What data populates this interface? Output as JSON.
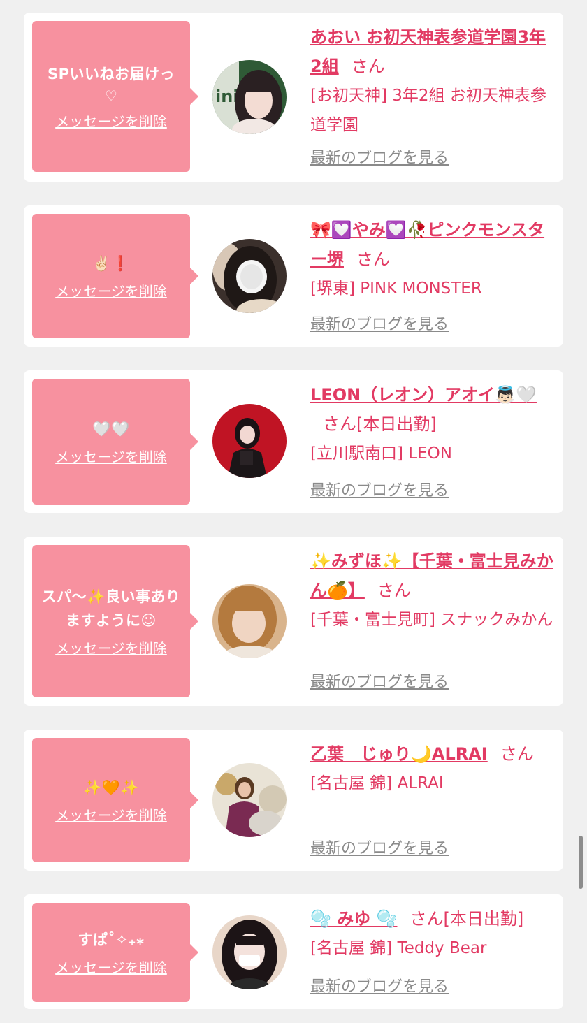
{
  "colors": {
    "accent": "#e23a63",
    "message_bg": "#f7919f",
    "page_bg": "#f0f0f0",
    "link_gray": "#8a8a8a"
  },
  "entries": [
    {
      "message": "SPいいねお届けっ",
      "message_sub": "♡",
      "delete_label": "メッセージを削除",
      "name": "あおい お初天神表参道学園3年2組",
      "honorific": "さん",
      "extra": "",
      "shop": "[お初天神] 3年2組 お初天神表参道学園",
      "blog_label": "最新のブログを見る"
    },
    {
      "message": "✌🏻❗️",
      "message_sub": "",
      "delete_label": "メッセージを削除",
      "name": "🎀💟やみ💟🥀ピンクモンスター堺",
      "honorific": "さん",
      "extra": "",
      "shop": "[堺東] PINK MONSTER",
      "blog_label": "最新のブログを見る"
    },
    {
      "message": "🤍🤍",
      "message_sub": "",
      "delete_label": "メッセージを削除",
      "name": "LEON（レオン）アオイ👼🏻🤍",
      "honorific": "さん",
      "extra": "[本日出勤]",
      "shop": "[立川駅南口] LEON",
      "blog_label": "最新のブログを見る"
    },
    {
      "message": "スパ〜✨良い事ありますように☺︎",
      "message_sub": "",
      "delete_label": "メッセージを削除",
      "name": "✨みずほ✨【千葉・富士見みかん🍊】",
      "honorific": "さん",
      "extra": "",
      "shop": "[千葉・富士見町] スナックみかん",
      "blog_label": "最新のブログを見る"
    },
    {
      "message": "✨🧡✨",
      "message_sub": "",
      "delete_label": "メッセージを削除",
      "name": "乙葉　じゅり🌙ALRAI",
      "honorific": "さん",
      "extra": "",
      "shop": "[名古屋 錦] ALRAI",
      "blog_label": "最新のブログを見る"
    },
    {
      "message": "すぱ˚✧₊⁎",
      "message_sub": "",
      "delete_label": "メッセージを削除",
      "name": "🫧 みゆ 🫧",
      "honorific": "さん",
      "extra": "[本日出勤]",
      "shop": "[名古屋 錦] Teddy Bear",
      "blog_label": "最新のブログを見る"
    }
  ]
}
